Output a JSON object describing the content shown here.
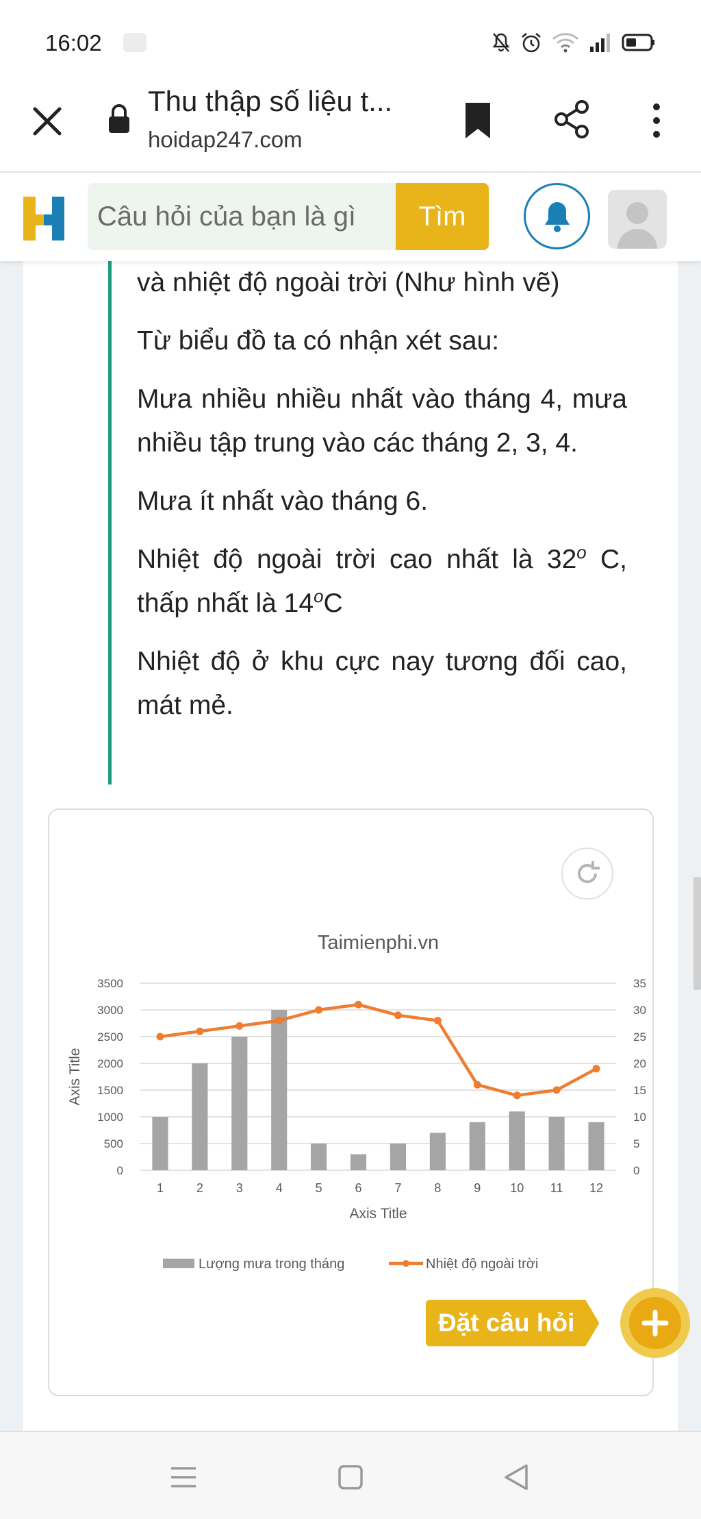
{
  "status_bar": {
    "time": "16:02",
    "icons": [
      "notification-icon",
      "mute-icon",
      "alarm-icon",
      "wifi-icon",
      "signal-icon",
      "battery-icon"
    ]
  },
  "browser": {
    "page_title": "Thu thập số liệu t...",
    "url": "hoidap247.com",
    "icons": [
      "close-icon",
      "lock-icon",
      "bookmark-icon",
      "share-icon",
      "more-icon"
    ]
  },
  "site_header": {
    "logo_letter": "H",
    "search_placeholder": "Câu hỏi của bạn là gì",
    "search_button": "Tìm",
    "colors": {
      "brand_yellow": "#e8b419",
      "brand_blue": "#1a7fb5",
      "search_bg": "#eef5ee"
    }
  },
  "answer": {
    "line_1": "và nhiệt độ ngoài trời (Như hình vẽ)",
    "line_2": "Từ biểu đồ ta có nhận xét sau:",
    "line_3": "Mưa nhiều nhiều nhất vào tháng 4, mưa nhiều tập trung vào các tháng 2, 3, 4.",
    "line_4": "Mưa ít nhất vào tháng 6.",
    "line_5_a": "Nhiệt độ ngoài trời cao nhất là 32",
    "line_5_sup1": "o",
    "line_5_b": "C, thấp nhất là 14",
    "line_5_sup2": "o",
    "line_5_c": "C",
    "line_6": "Nhiệt độ ở khu cực nay tương đối cao, mát mẻ.",
    "accent_color": "#1f9e82"
  },
  "chart_data": {
    "type": "bar",
    "title": "Taimienphi.vn",
    "xlabel": "Axis Title",
    "ylabel": "Axis Title",
    "categories": [
      "1",
      "2",
      "3",
      "4",
      "5",
      "6",
      "7",
      "8",
      "9",
      "10",
      "11",
      "12"
    ],
    "series": [
      {
        "name": "Lượng mưa trong tháng",
        "type": "bar",
        "axis": "left",
        "color": "#a5a5a5",
        "values": [
          1000,
          2000,
          2500,
          3000,
          500,
          300,
          500,
          700,
          900,
          1100,
          1000,
          900
        ]
      },
      {
        "name": "Nhiệt độ ngoài trời",
        "type": "line",
        "axis": "right",
        "color": "#ed7d31",
        "values": [
          25,
          26,
          27,
          28,
          30,
          31,
          29,
          28,
          16,
          14,
          15,
          19
        ]
      }
    ],
    "ylim_left": [
      0,
      3500
    ],
    "yticks_left": [
      "0",
      "500",
      "1000",
      "1500",
      "2000",
      "2500",
      "3000",
      "3500"
    ],
    "ylim_right": [
      0,
      35
    ],
    "yticks_right": [
      "0",
      "5",
      "10",
      "15",
      "20",
      "25",
      "30",
      "35"
    ],
    "grid": true,
    "legend_position": "bottom"
  },
  "fab": {
    "label": "Đặt câu hỏi",
    "icon": "plus-icon"
  },
  "nav_bar": {
    "icons": [
      "menu-icon",
      "home-icon",
      "back-icon"
    ]
  }
}
